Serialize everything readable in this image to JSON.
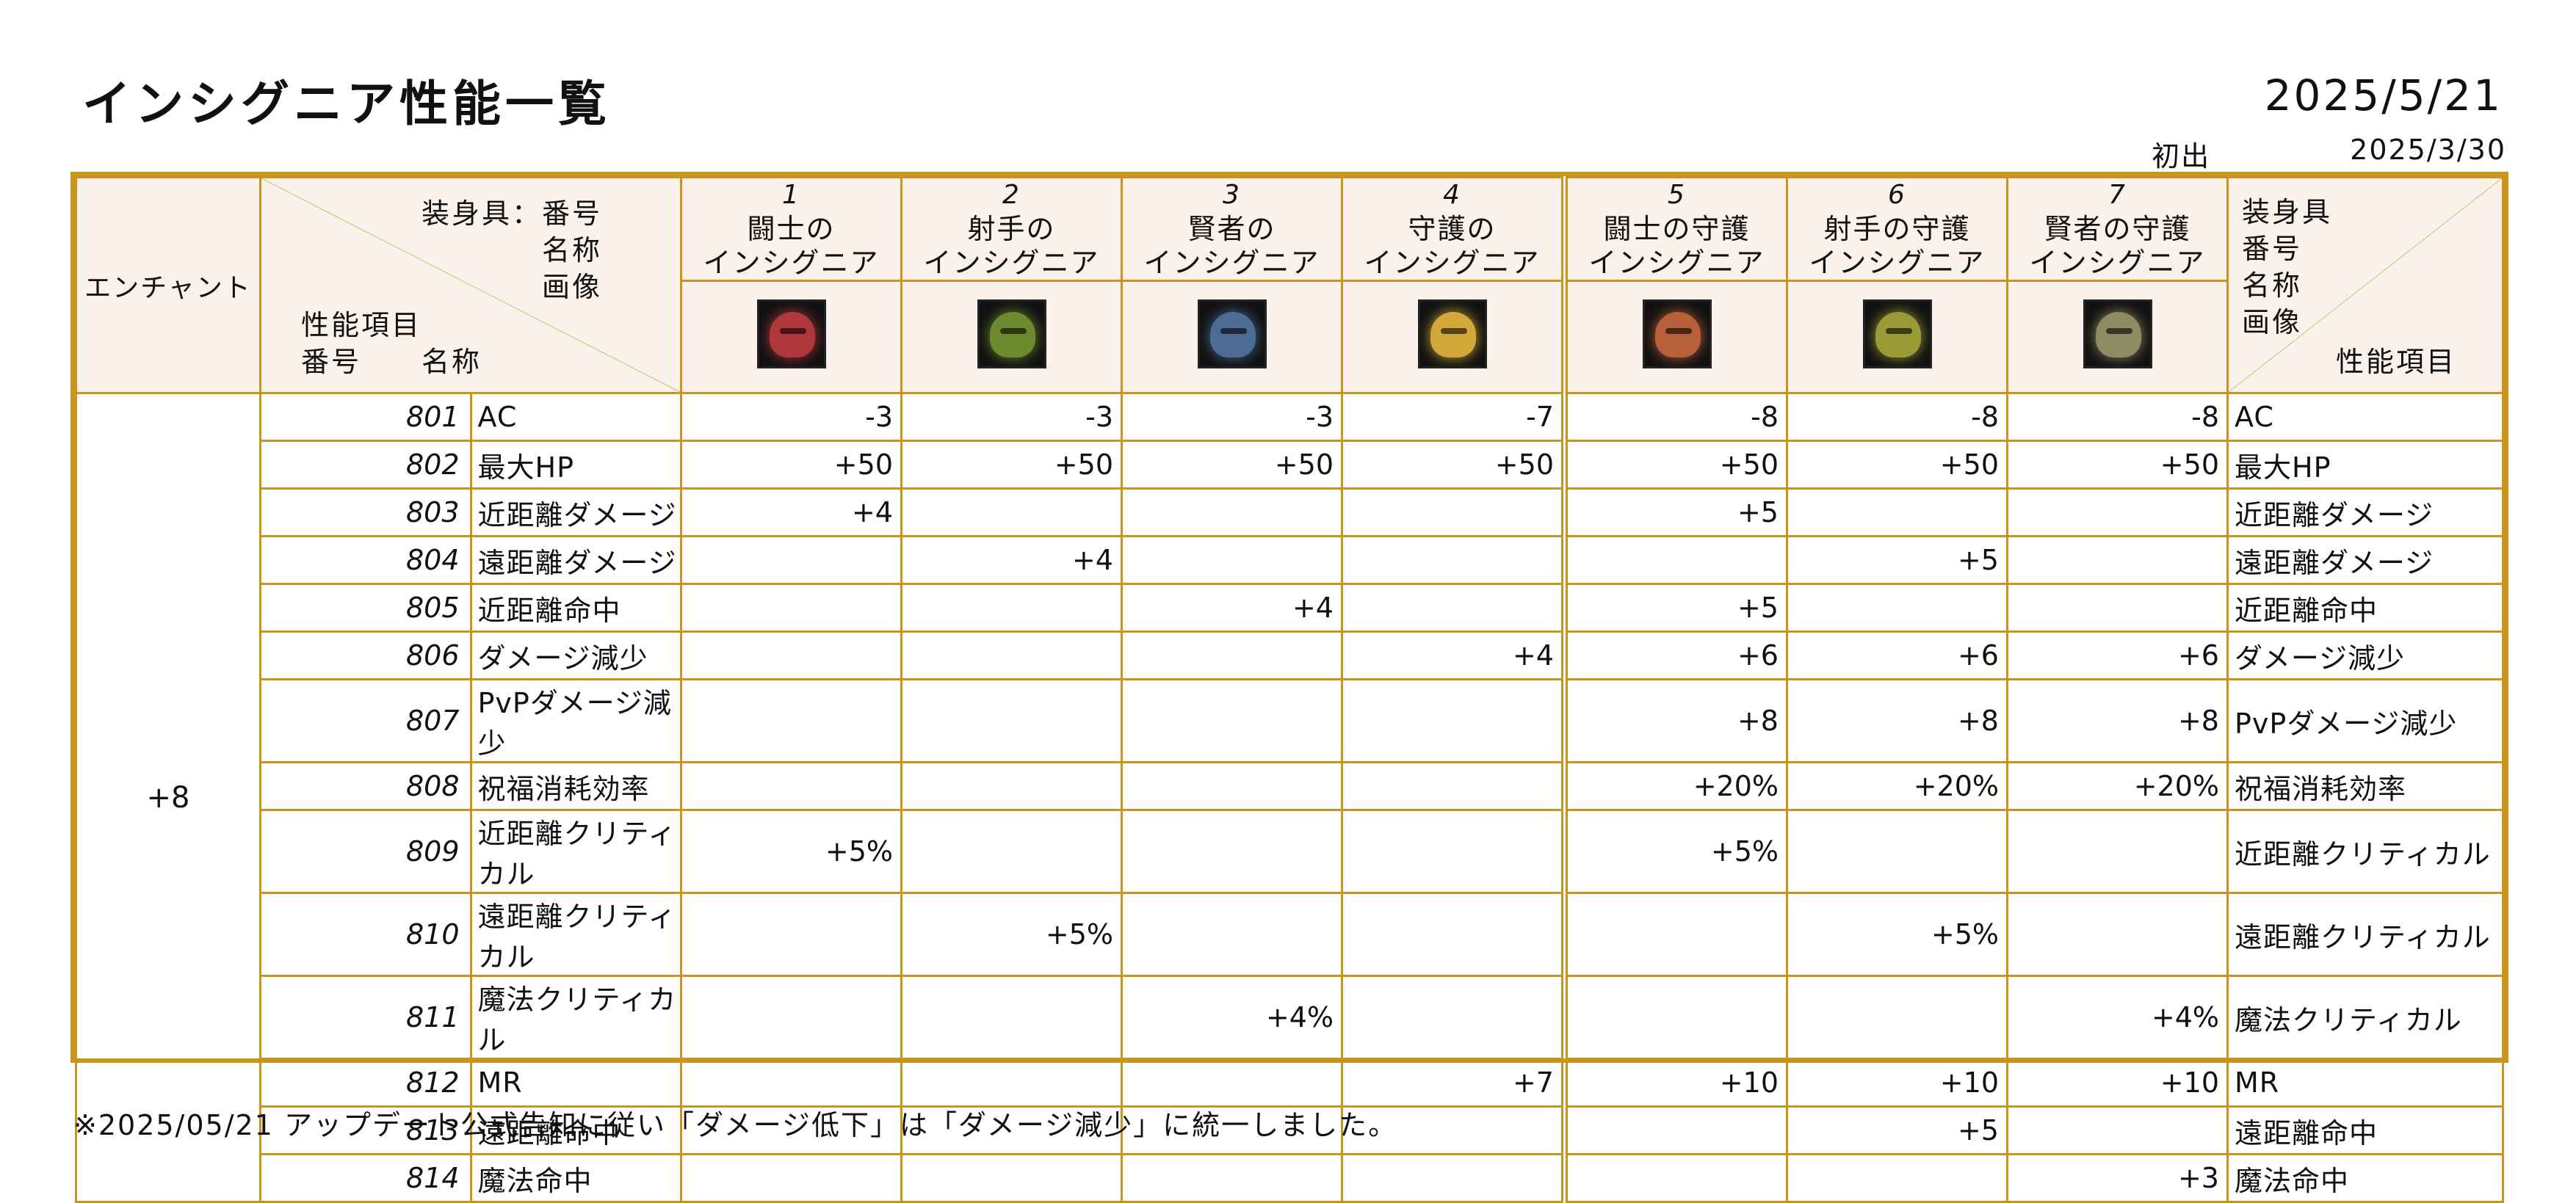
{
  "header": {
    "title": "インシグニア性能一覧",
    "date": "2025/5/21",
    "first_label": "初出",
    "first_date": "2025/3/30"
  },
  "table": {
    "enchant_header": "エンチャント",
    "diag": {
      "top_line1": "装身具：番号",
      "top_line2": "名称",
      "top_line3": "画像",
      "bottom_line1": "性能項目",
      "bottom_line2": "番号　　名称"
    },
    "right_diag": {
      "line1": "装身具",
      "line2": "番号",
      "line3": "名称",
      "line4": "画像",
      "bottom": "性能項目"
    },
    "columns": [
      {
        "num": "1",
        "name1": "闘士の",
        "name2": "インシグニア",
        "icon": "red-insignia-icon",
        "color": "#B0383C"
      },
      {
        "num": "2",
        "name1": "射手の",
        "name2": "インシグニア",
        "icon": "green-insignia-icon",
        "color": "#6E8A2E"
      },
      {
        "num": "3",
        "name1": "賢者の",
        "name2": "インシグニア",
        "icon": "blue-insignia-icon",
        "color": "#4C6C94"
      },
      {
        "num": "4",
        "name1": "守護の",
        "name2": "インシグニア",
        "icon": "gold-insignia-icon",
        "color": "#D2A83A"
      },
      {
        "num": "5",
        "name1": "闘士の守護",
        "name2": "インシグニア",
        "icon": "red-gold-insignia-icon",
        "color": "#B8603A"
      },
      {
        "num": "6",
        "name1": "射手の守護",
        "name2": "インシグニア",
        "icon": "green-gold-insignia-icon",
        "color": "#9A9A36"
      },
      {
        "num": "7",
        "name1": "賢者の守護",
        "name2": "インシグニア",
        "icon": "blue-gold-insignia-icon",
        "color": "#8E8A62"
      }
    ],
    "enchant_value": "+8",
    "rows": [
      {
        "no": "801",
        "name": "AC",
        "values": [
          "-3",
          "-3",
          "-3",
          "-7",
          "-8",
          "-8",
          "-8"
        ]
      },
      {
        "no": "802",
        "name": "最大HP",
        "values": [
          "+50",
          "+50",
          "+50",
          "+50",
          "+50",
          "+50",
          "+50"
        ]
      },
      {
        "no": "803",
        "name": "近距離ダメージ",
        "values": [
          "+4",
          "",
          "",
          "",
          "+5",
          "",
          ""
        ]
      },
      {
        "no": "804",
        "name": "遠距離ダメージ",
        "values": [
          "",
          "+4",
          "",
          "",
          "",
          "+5",
          ""
        ]
      },
      {
        "no": "805",
        "name": "近距離命中",
        "values": [
          "",
          "",
          "+4",
          "",
          "+5",
          "",
          ""
        ]
      },
      {
        "no": "806",
        "name": "ダメージ減少",
        "values": [
          "",
          "",
          "",
          "+4",
          "+6",
          "+6",
          "+6"
        ]
      },
      {
        "no": "807",
        "name": "PvPダメージ減少",
        "values": [
          "",
          "",
          "",
          "",
          "+8",
          "+8",
          "+8"
        ]
      },
      {
        "no": "808",
        "name": "祝福消耗効率",
        "values": [
          "",
          "",
          "",
          "",
          "+20%",
          "+20%",
          "+20%"
        ]
      },
      {
        "no": "809",
        "name": "近距離クリティカル",
        "values": [
          "+5%",
          "",
          "",
          "",
          "+5%",
          "",
          ""
        ]
      },
      {
        "no": "810",
        "name": "遠距離クリティカル",
        "values": [
          "",
          "+5%",
          "",
          "",
          "",
          "+5%",
          ""
        ]
      },
      {
        "no": "811",
        "name": "魔法クリティカル",
        "values": [
          "",
          "",
          "+4%",
          "",
          "",
          "",
          "+4%"
        ]
      },
      {
        "no": "812",
        "name": "MR",
        "values": [
          "",
          "",
          "",
          "+7",
          "+10",
          "+10",
          "+10"
        ]
      },
      {
        "no": "813",
        "name": "遠距離命中",
        "values": [
          "",
          "",
          "",
          "",
          "",
          "+5",
          ""
        ]
      },
      {
        "no": "814",
        "name": "魔法命中",
        "values": [
          "",
          "",
          "",
          "",
          "",
          "",
          "+3"
        ]
      }
    ]
  },
  "note": "※2025/05/21 アップデート公式告知に従い「ダメージ低下」は「ダメージ減少」に統一しました。"
}
